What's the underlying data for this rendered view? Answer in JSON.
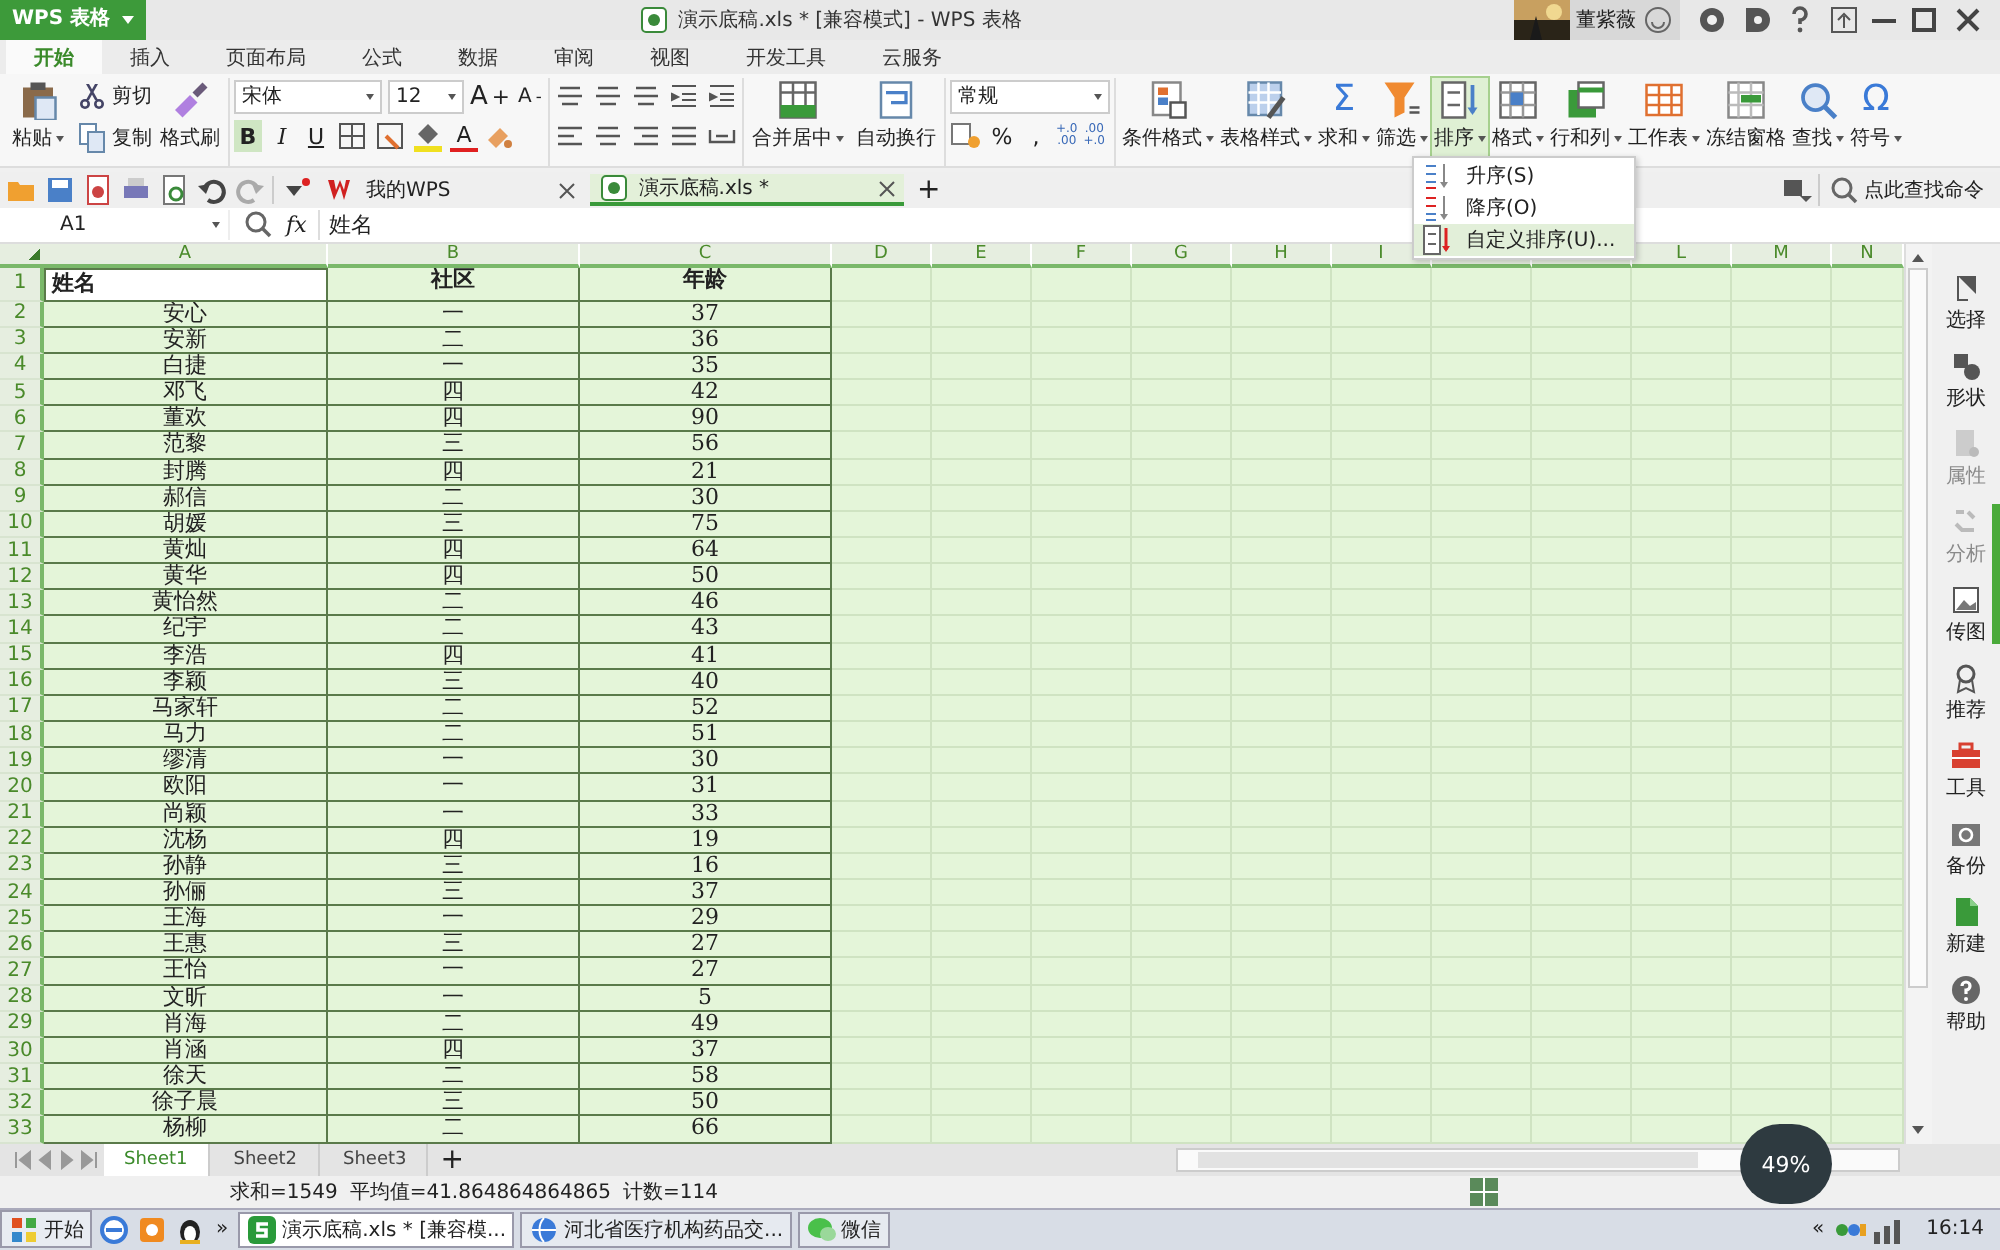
{
  "app_button": {
    "label": "WPS 表格"
  },
  "window": {
    "title": "演示底稿.xls * [兼容模式] - WPS 表格",
    "user": "董紫薇"
  },
  "menu_tabs": [
    {
      "label": "开始",
      "selected": true
    },
    {
      "label": "插入",
      "selected": false
    },
    {
      "label": "页面布局",
      "selected": false
    },
    {
      "label": "公式",
      "selected": false
    },
    {
      "label": "数据",
      "selected": false
    },
    {
      "label": "审阅",
      "selected": false
    },
    {
      "label": "视图",
      "selected": false
    },
    {
      "label": "开发工具",
      "selected": false
    },
    {
      "label": "云服务",
      "selected": false
    }
  ],
  "ribbon": {
    "paste": {
      "label": "粘贴",
      "dropdown": true
    },
    "cut": {
      "label": "剪切"
    },
    "copy": {
      "label": "复制"
    },
    "format_painter": {
      "label": "格式刷"
    },
    "font_name": "宋体",
    "font_size": "12",
    "grow_font": {
      "label": "A",
      "sign": "+"
    },
    "shrink_font": {
      "label": "A",
      "sign": "-"
    },
    "bold": {
      "label": "B",
      "selected": true
    },
    "italic": {
      "label": "I",
      "selected": false
    },
    "underline": {
      "label": "U",
      "selected": false
    },
    "font_color": "A",
    "merge": {
      "label": "合并居中",
      "dropdown": true
    },
    "wrap": {
      "label": "自动换行",
      "dropdown": false
    },
    "number_format": "常规",
    "percent": "%",
    "comma": ",",
    "decimals": [
      [
        "+.0",
        ".00"
      ],
      [
        ".00",
        "+.0"
      ]
    ],
    "tools": [
      {
        "label": "条件格式",
        "dropdown": true,
        "selected": false
      },
      {
        "label": "表格样式",
        "dropdown": true,
        "selected": false
      },
      {
        "label": "求和",
        "dropdown": true,
        "selected": false,
        "symbol": "Σ"
      },
      {
        "label": "筛选",
        "dropdown": true,
        "selected": false
      },
      {
        "label": "排序",
        "dropdown": true,
        "selected": true
      },
      {
        "label": "格式",
        "dropdown": true,
        "selected": false
      },
      {
        "label": "行和列",
        "dropdown": true,
        "selected": false
      },
      {
        "label": "工作表",
        "dropdown": true,
        "selected": false
      },
      {
        "label": "冻结窗格",
        "dropdown": false,
        "selected": false
      },
      {
        "label": "查找",
        "dropdown": true,
        "selected": false
      },
      {
        "label": "符号",
        "dropdown": true,
        "selected": false,
        "symbol": "Ω"
      }
    ]
  },
  "sort_menu": [
    {
      "label": "升序(S)",
      "selected": false
    },
    {
      "label": "降序(O)",
      "selected": false
    },
    {
      "label": "自定义排序(U)...",
      "selected": true
    }
  ],
  "doc_tabs": [
    {
      "label": "我的WPS",
      "selected": false
    },
    {
      "label": "演示底稿.xls *",
      "selected": true
    }
  ],
  "new_tab": "+",
  "command_search": {
    "placeholder": "点此查找命令"
  },
  "formula_bar": {
    "name_box": "A1",
    "fx": "fx",
    "value": "姓名"
  },
  "columns": [
    "A",
    "B",
    "C",
    "D",
    "E",
    "F",
    "G",
    "H",
    "I",
    "L",
    "M",
    "N"
  ],
  "rows": [
    {
      "n": "1",
      "cells": [
        {
          "text": "姓名",
          "selected": true
        },
        {
          "text": "社区",
          "selected": false
        },
        {
          "text": "年龄",
          "selected": false
        }
      ]
    },
    {
      "n": "2",
      "cells": [
        {
          "text": "安心",
          "selected": false
        },
        {
          "text": "一",
          "selected": false
        },
        {
          "text": "37",
          "selected": false
        }
      ]
    },
    {
      "n": "3",
      "cells": [
        {
          "text": "安新",
          "selected": false
        },
        {
          "text": "二",
          "selected": false
        },
        {
          "text": "36",
          "selected": false
        }
      ]
    },
    {
      "n": "4",
      "cells": [
        {
          "text": "白捷",
          "selected": false
        },
        {
          "text": "一",
          "selected": false
        },
        {
          "text": "35",
          "selected": false
        }
      ]
    },
    {
      "n": "5",
      "cells": [
        {
          "text": "邓飞",
          "selected": false
        },
        {
          "text": "四",
          "selected": false
        },
        {
          "text": "42",
          "selected": false
        }
      ]
    },
    {
      "n": "6",
      "cells": [
        {
          "text": "董欢",
          "selected": false
        },
        {
          "text": "四",
          "selected": false
        },
        {
          "text": "90",
          "selected": false
        }
      ]
    },
    {
      "n": "7",
      "cells": [
        {
          "text": "范黎",
          "selected": false
        },
        {
          "text": "三",
          "selected": false
        },
        {
          "text": "56",
          "selected": false
        }
      ]
    },
    {
      "n": "8",
      "cells": [
        {
          "text": "封腾",
          "selected": false
        },
        {
          "text": "四",
          "selected": false
        },
        {
          "text": "21",
          "selected": false
        }
      ]
    },
    {
      "n": "9",
      "cells": [
        {
          "text": "郝信",
          "selected": false
        },
        {
          "text": "二",
          "selected": false
        },
        {
          "text": "30",
          "selected": false
        }
      ]
    },
    {
      "n": "10",
      "cells": [
        {
          "text": "胡媛",
          "selected": false
        },
        {
          "text": "三",
          "selected": false
        },
        {
          "text": "75",
          "selected": false
        }
      ]
    },
    {
      "n": "11",
      "cells": [
        {
          "text": "黄灿",
          "selected": false
        },
        {
          "text": "四",
          "selected": false
        },
        {
          "text": "64",
          "selected": false
        }
      ]
    },
    {
      "n": "12",
      "cells": [
        {
          "text": "黄华",
          "selected": false
        },
        {
          "text": "四",
          "selected": false
        },
        {
          "text": "50",
          "selected": false
        }
      ]
    },
    {
      "n": "13",
      "cells": [
        {
          "text": "黄怡然",
          "selected": false
        },
        {
          "text": "二",
          "selected": false
        },
        {
          "text": "46",
          "selected": false
        }
      ]
    },
    {
      "n": "14",
      "cells": [
        {
          "text": "纪宇",
          "selected": false
        },
        {
          "text": "二",
          "selected": false
        },
        {
          "text": "43",
          "selected": false
        }
      ]
    },
    {
      "n": "15",
      "cells": [
        {
          "text": "李浩",
          "selected": false
        },
        {
          "text": "四",
          "selected": false
        },
        {
          "text": "41",
          "selected": false
        }
      ]
    },
    {
      "n": "16",
      "cells": [
        {
          "text": "李颖",
          "selected": false
        },
        {
          "text": "三",
          "selected": false
        },
        {
          "text": "40",
          "selected": false
        }
      ]
    },
    {
      "n": "17",
      "cells": [
        {
          "text": "马家轩",
          "selected": false
        },
        {
          "text": "二",
          "selected": false
        },
        {
          "text": "52",
          "selected": false
        }
      ]
    },
    {
      "n": "18",
      "cells": [
        {
          "text": "马力",
          "selected": false
        },
        {
          "text": "二",
          "selected": false
        },
        {
          "text": "51",
          "selected": false
        }
      ]
    },
    {
      "n": "19",
      "cells": [
        {
          "text": "缪清",
          "selected": false
        },
        {
          "text": "一",
          "selected": false
        },
        {
          "text": "30",
          "selected": false
        }
      ]
    },
    {
      "n": "20",
      "cells": [
        {
          "text": "欧阳",
          "selected": false
        },
        {
          "text": "一",
          "selected": false
        },
        {
          "text": "31",
          "selected": false
        }
      ]
    },
    {
      "n": "21",
      "cells": [
        {
          "text": "尚颖",
          "selected": false
        },
        {
          "text": "一",
          "selected": false
        },
        {
          "text": "33",
          "selected": false
        }
      ]
    },
    {
      "n": "22",
      "cells": [
        {
          "text": "沈杨",
          "selected": false
        },
        {
          "text": "四",
          "selected": false
        },
        {
          "text": "19",
          "selected": false
        }
      ]
    },
    {
      "n": "23",
      "cells": [
        {
          "text": "孙静",
          "selected": false
        },
        {
          "text": "三",
          "selected": false
        },
        {
          "text": "16",
          "selected": false
        }
      ]
    },
    {
      "n": "24",
      "cells": [
        {
          "text": "孙俪",
          "selected": false
        },
        {
          "text": "三",
          "selected": false
        },
        {
          "text": "37",
          "selected": false
        }
      ]
    },
    {
      "n": "25",
      "cells": [
        {
          "text": "王海",
          "selected": false
        },
        {
          "text": "一",
          "selected": false
        },
        {
          "text": "29",
          "selected": false
        }
      ]
    },
    {
      "n": "26",
      "cells": [
        {
          "text": "王惠",
          "selected": false
        },
        {
          "text": "三",
          "selected": false
        },
        {
          "text": "27",
          "selected": false
        }
      ]
    },
    {
      "n": "27",
      "cells": [
        {
          "text": "王怡",
          "selected": false
        },
        {
          "text": "一",
          "selected": false
        },
        {
          "text": "27",
          "selected": false
        }
      ]
    },
    {
      "n": "28",
      "cells": [
        {
          "text": "文昕",
          "selected": false
        },
        {
          "text": "一",
          "selected": false
        },
        {
          "text": "5",
          "selected": false
        }
      ]
    },
    {
      "n": "29",
      "cells": [
        {
          "text": "肖海",
          "selected": false
        },
        {
          "text": "二",
          "selected": false
        },
        {
          "text": "49",
          "selected": false
        }
      ]
    },
    {
      "n": "30",
      "cells": [
        {
          "text": "肖涵",
          "selected": false
        },
        {
          "text": "四",
          "selected": false
        },
        {
          "text": "37",
          "selected": false
        }
      ]
    },
    {
      "n": "31",
      "cells": [
        {
          "text": "徐天",
          "selected": false
        },
        {
          "text": "二",
          "selected": false
        },
        {
          "text": "58",
          "selected": false
        }
      ]
    },
    {
      "n": "32",
      "cells": [
        {
          "text": "徐子晨",
          "selected": false
        },
        {
          "text": "三",
          "selected": false
        },
        {
          "text": "50",
          "selected": false
        }
      ]
    },
    {
      "n": "33",
      "cells": [
        {
          "text": "杨柳",
          "selected": false
        },
        {
          "text": "二",
          "selected": false
        },
        {
          "text": "66",
          "selected": false
        }
      ]
    }
  ],
  "sheet_tabs": [
    {
      "label": "Sheet1",
      "selected": true
    },
    {
      "label": "Sheet2",
      "selected": false
    },
    {
      "label": "Sheet3",
      "selected": false
    }
  ],
  "add_sheet": "+",
  "status_bar": {
    "sum": "求和=1549",
    "average": "平均值=41.864864864865",
    "count": "计数=114"
  },
  "speed_widget": {
    "value": "49%"
  },
  "sidebar": [
    {
      "label": "选择",
      "disabled": false
    },
    {
      "label": "形状",
      "disabled": false
    },
    {
      "label": "属性",
      "disabled": true
    },
    {
      "label": "分析",
      "disabled": true
    },
    {
      "label": "传图",
      "disabled": false
    },
    {
      "label": "推荐",
      "disabled": false
    },
    {
      "label": "工具",
      "disabled": false
    },
    {
      "label": "备份",
      "disabled": false
    },
    {
      "label": "新建",
      "disabled": false
    },
    {
      "label": "帮助",
      "disabled": false
    }
  ],
  "taskbar": {
    "start": "开始",
    "more": "»",
    "tasks": [
      {
        "label": "演示底稿.xls * [兼容模...",
        "selected": true
      },
      {
        "label": "河北省医疗机构药品交...",
        "selected": false
      },
      {
        "label": "微信",
        "selected": false
      }
    ],
    "tray_more": "«",
    "clock": "16:14"
  }
}
